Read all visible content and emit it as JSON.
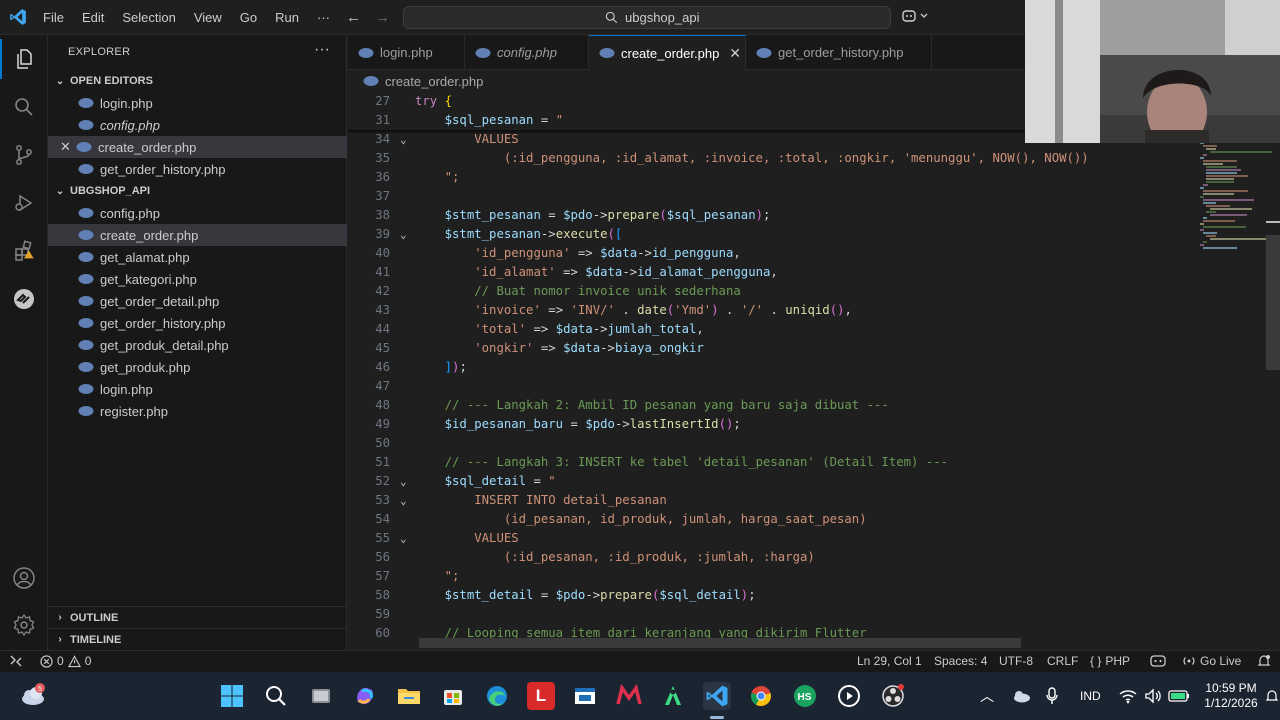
{
  "menu": [
    "File",
    "Edit",
    "Selection",
    "View",
    "Go",
    "Run",
    "···"
  ],
  "search": {
    "text": "ubgshop_api"
  },
  "explorer": {
    "title": "EXPLORER",
    "more": "···",
    "open_editors_title": "OPEN EDITORS",
    "open_editors": [
      {
        "label": "login.php",
        "italic": false
      },
      {
        "label": "config.php",
        "italic": true
      },
      {
        "label": "create_order.php",
        "italic": false,
        "selected": true
      },
      {
        "label": "get_order_history.php",
        "italic": false
      }
    ],
    "folder_title": "UBGSHOP_API",
    "files": [
      "config.php",
      "create_order.php",
      "get_alamat.php",
      "get_kategori.php",
      "get_order_detail.php",
      "get_order_history.php",
      "get_produk_detail.php",
      "get_produk.php",
      "login.php",
      "register.php"
    ],
    "outline_title": "OUTLINE",
    "timeline_title": "TIMELINE"
  },
  "tabs": [
    {
      "label": "login.php"
    },
    {
      "label": "config.php"
    },
    {
      "label": "create_order.php",
      "close": "✕"
    },
    {
      "label": "get_order_history.php"
    }
  ],
  "breadcrumb": {
    "file": "create_order.php"
  },
  "code_lines": [
    {
      "n": "27",
      "fold": "",
      "code": "try {"
    },
    {
      "n": "31",
      "fold": "",
      "code": "    $sql_pesanan = \""
    },
    {
      "n": "34",
      "fold": "⌄",
      "code": "        VALUES"
    },
    {
      "n": "35",
      "fold": "",
      "code": "            (:id_pengguna, :id_alamat, :invoice, :total, :ongkir, 'menunggu', NOW(), NOW())"
    },
    {
      "n": "36",
      "fold": "",
      "code": "    \";"
    },
    {
      "n": "37",
      "fold": "",
      "code": ""
    },
    {
      "n": "38",
      "fold": "",
      "code": "    $stmt_pesanan = $pdo->prepare($sql_pesanan);"
    },
    {
      "n": "39",
      "fold": "⌄",
      "code": "    $stmt_pesanan->execute(["
    },
    {
      "n": "40",
      "fold": "",
      "code": "        'id_pengguna' => $data->id_pengguna,"
    },
    {
      "n": "41",
      "fold": "",
      "code": "        'id_alamat' => $data->id_alamat_pengguna,"
    },
    {
      "n": "42",
      "fold": "",
      "code": "        // Buat nomor invoice unik sederhana"
    },
    {
      "n": "43",
      "fold": "",
      "code": "        'invoice' => 'INV/' . date('Ymd') . '/' . uniqid(),"
    },
    {
      "n": "44",
      "fold": "",
      "code": "        'total' => $data->jumlah_total,"
    },
    {
      "n": "45",
      "fold": "",
      "code": "        'ongkir' => $data->biaya_ongkir"
    },
    {
      "n": "46",
      "fold": "",
      "code": "    ]);"
    },
    {
      "n": "47",
      "fold": "",
      "code": ""
    },
    {
      "n": "48",
      "fold": "",
      "code": "    // --- Langkah 2: Ambil ID pesanan yang baru saja dibuat ---"
    },
    {
      "n": "49",
      "fold": "",
      "code": "    $id_pesanan_baru = $pdo->lastInsertId();"
    },
    {
      "n": "50",
      "fold": "",
      "code": ""
    },
    {
      "n": "51",
      "fold": "",
      "code": "    // --- Langkah 3: INSERT ke tabel 'detail_pesanan' (Detail Item) ---"
    },
    {
      "n": "52",
      "fold": "⌄",
      "code": "    $sql_detail = \""
    },
    {
      "n": "53",
      "fold": "⌄",
      "code": "        INSERT INTO detail_pesanan"
    },
    {
      "n": "54",
      "fold": "",
      "code": "            (id_pesanan, id_produk, jumlah, harga_saat_pesan)"
    },
    {
      "n": "55",
      "fold": "⌄",
      "code": "        VALUES"
    },
    {
      "n": "56",
      "fold": "",
      "code": "            (:id_pesanan, :id_produk, :jumlah, :harga)"
    },
    {
      "n": "57",
      "fold": "",
      "code": "    \";"
    },
    {
      "n": "58",
      "fold": "",
      "code": "    $stmt_detail = $pdo->prepare($sql_detail);"
    },
    {
      "n": "59",
      "fold": "",
      "code": ""
    },
    {
      "n": "60",
      "fold": "",
      "code": "    // Looping semua item dari keranjang yang dikirim Flutter"
    }
  ],
  "status": {
    "errors": "0",
    "warnings": "0",
    "position": "Ln 29, Col 1",
    "spaces": "Spaces: 4",
    "encoding": "UTF-8",
    "eol": "CRLF",
    "braces": "{ }",
    "language": "PHP",
    "golive": "Go Live"
  },
  "taskbar": {
    "lang": "IND",
    "time": "10:59 PM",
    "date": "1/12/2026",
    "weather_badge": "5",
    "hs_label": "HS",
    "l_label": "L"
  },
  "colors": {
    "accent": "#0078d4",
    "keyword": "#c586c0",
    "variable": "#9cdcfe",
    "function": "#dcdcaa",
    "string": "#ce9178",
    "comment": "#6a9955",
    "php_icon": "#6181b6"
  }
}
